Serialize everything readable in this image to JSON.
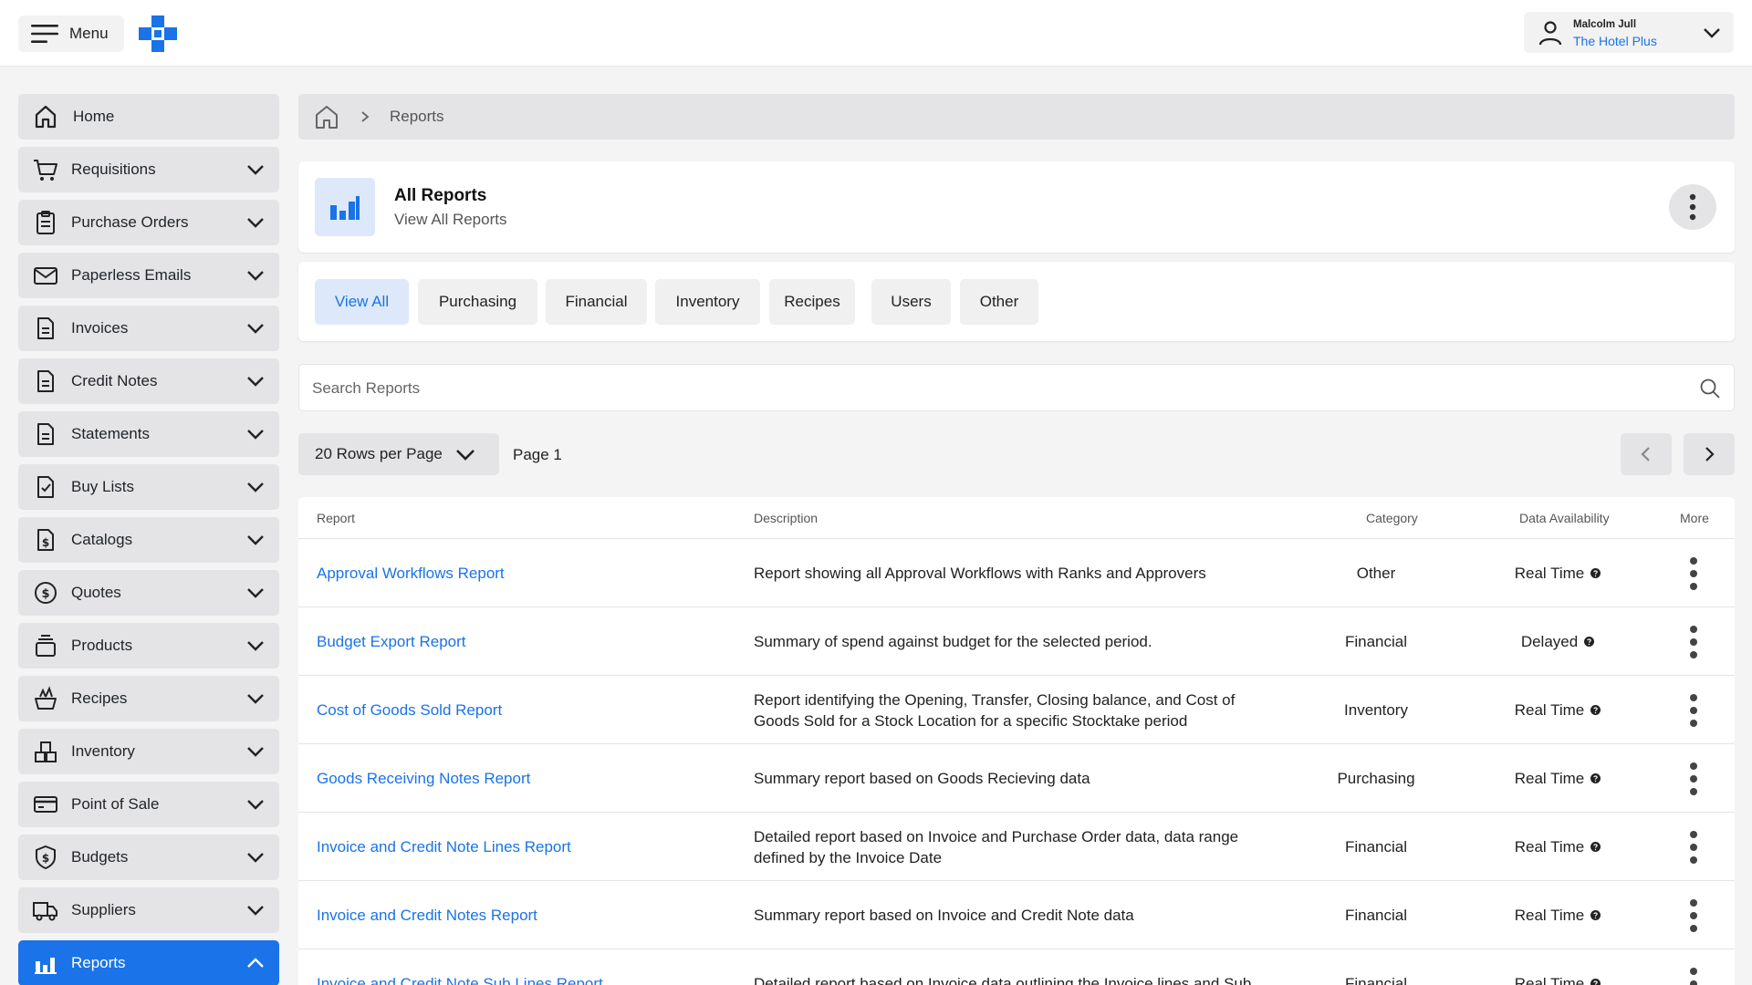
{
  "topbar": {
    "menu_label": "Menu",
    "user_name": "Malcolm Jull",
    "user_org": "The Hotel Plus"
  },
  "sidebar": {
    "items": [
      {
        "label": "Home",
        "icon": "home-icon"
      },
      {
        "label": "Requisitions",
        "icon": "cart-icon"
      },
      {
        "label": "Purchase Orders",
        "icon": "clipboard-icon"
      },
      {
        "label": "Paperless Emails",
        "icon": "envelope-icon"
      },
      {
        "label": "Invoices",
        "icon": "document-icon"
      },
      {
        "label": "Credit Notes",
        "icon": "document-icon"
      },
      {
        "label": "Statements",
        "icon": "document-icon"
      },
      {
        "label": "Buy Lists",
        "icon": "checklist-icon"
      },
      {
        "label": "Catalogs",
        "icon": "dollar-document-icon"
      },
      {
        "label": "Quotes",
        "icon": "dollar-circle-icon"
      },
      {
        "label": "Products",
        "icon": "stack-icon"
      },
      {
        "label": "Recipes",
        "icon": "pot-icon"
      },
      {
        "label": "Inventory",
        "icon": "boxes-icon"
      },
      {
        "label": "Point of Sale",
        "icon": "card-icon"
      },
      {
        "label": "Budgets",
        "icon": "dollar-shield-icon"
      },
      {
        "label": "Suppliers",
        "icon": "truck-icon"
      },
      {
        "label": "Reports",
        "icon": "bar-chart-icon"
      }
    ]
  },
  "breadcrumb": {
    "current": "Reports"
  },
  "header": {
    "title": "All Reports",
    "subtitle": "View All Reports"
  },
  "tabs": [
    {
      "label": "View All"
    },
    {
      "label": "Purchasing"
    },
    {
      "label": "Financial"
    },
    {
      "label": "Inventory"
    },
    {
      "label": "Recipes"
    },
    {
      "label": "Users"
    },
    {
      "label": "Other"
    }
  ],
  "search": {
    "placeholder": "Search Reports"
  },
  "pagination": {
    "rows_label": "20 Rows per Page",
    "page_label": "Page 1"
  },
  "table": {
    "headers": {
      "report": "Report",
      "description": "Description",
      "category": "Category",
      "availability": "Data Availability",
      "more": "More"
    },
    "rows": [
      {
        "name": "Approval Workflows Report",
        "description": "Report showing all Approval Workflows with Ranks and Approvers",
        "category": "Other",
        "availability": "Real Time"
      },
      {
        "name": "Budget Export Report",
        "description": "Summary of spend against budget for the selected period.",
        "category": "Financial",
        "availability": "Delayed"
      },
      {
        "name": "Cost of Goods Sold Report",
        "description": "Report identifying the Opening, Transfer, Closing balance, and Cost of Goods Sold for a Stock Location for a specific Stocktake period",
        "category": "Inventory",
        "availability": "Real Time"
      },
      {
        "name": "Goods Receiving Notes Report",
        "description": "Summary report based on Goods Recieving data",
        "category": "Purchasing",
        "availability": "Real Time"
      },
      {
        "name": "Invoice and Credit Note Lines Report",
        "description": "Detailed report based on Invoice and Purchase Order data, data range defined by the Invoice Date",
        "category": "Financial",
        "availability": "Real Time"
      },
      {
        "name": "Invoice and Credit Notes Report",
        "description": "Summary report based on Invoice and Credit Note data",
        "category": "Financial",
        "availability": "Real Time"
      },
      {
        "name": "Invoice and Credit Note Sub Lines Report",
        "description": "Detailed report based on Invoice data outlining the Invoice lines and Sub",
        "category": "Financial",
        "availability": "Real Time"
      }
    ]
  },
  "colors": {
    "accent": "#1a73e8",
    "accent_light": "#dde9fb",
    "panel": "#e4e4e6",
    "background": "#f4f4f5"
  }
}
